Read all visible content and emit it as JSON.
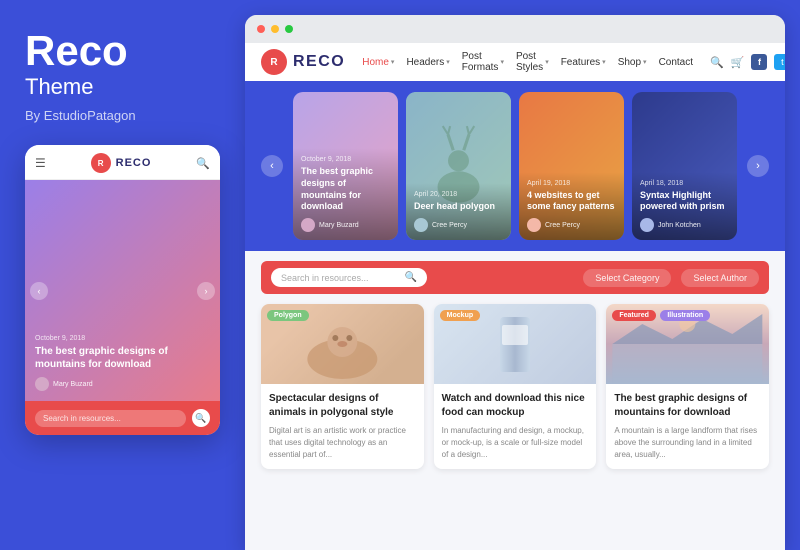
{
  "brand": {
    "title": "Reco",
    "subtitle": "Theme",
    "author": "By EstudioPatagon"
  },
  "mobile": {
    "logo": "R",
    "logo_text": "RECO",
    "hero_date": "October 9, 2018",
    "hero_title": "The best graphic designs of mountains for download",
    "hero_author": "Mary Buzard",
    "search_placeholder": "Search in resources...",
    "nav_prev": "‹",
    "nav_next": "›"
  },
  "browser": {
    "dots": [
      "#ff5f57",
      "#ffbd2e",
      "#28c941"
    ]
  },
  "site": {
    "logo": "R",
    "logo_text": "RECO",
    "nav": {
      "home": "Home",
      "headers": "Headers",
      "post_formats": "Post Formats",
      "post_styles": "Post Styles",
      "features": "Features",
      "shop": "Shop",
      "contact": "Contact"
    }
  },
  "hero_slider": {
    "nav_prev": "‹",
    "nav_next": "›",
    "cards": [
      {
        "date": "October 9, 2018",
        "title": "The best graphic designs of mountains for download",
        "author": "Mary Buzard",
        "bg": "card-bg-1"
      },
      {
        "date": "April 20, 2018",
        "title": "Deer head polygon",
        "author": "Cree Percy",
        "bg": "card-bg-2"
      },
      {
        "date": "April 19, 2018",
        "title": "4 websites to get some fancy patterns",
        "author": "Cree Percy",
        "bg": "card-bg-3"
      },
      {
        "date": "April 18, 2018",
        "title": "Syntax Highlight powered with prism",
        "author": "John Kotchen",
        "bg": "card-bg-4"
      }
    ]
  },
  "search_bar": {
    "placeholder": "Search in resources...",
    "search_icon": "🔍",
    "filter1": "Select Category",
    "filter2": "Select Author"
  },
  "articles": [
    {
      "tag": "Polygon",
      "tag_class": "tag-polygon",
      "title": "Spectacular designs of animals in polygonal style",
      "desc": "Digital art is an artistic work or practice that uses digital technology as an essential part of...",
      "img_class": "article-img-1"
    },
    {
      "tag": "Mockup",
      "tag_class": "tag-mockup",
      "title": "Watch and download this nice food can mockup",
      "desc": "In manufacturing and design, a mockup, or mock-up, is a scale or full-size model of a design...",
      "img_class": "article-img-2"
    },
    {
      "tag": "Featured",
      "tag_class": "tag-featured",
      "tag2": "Illustration",
      "tag2_class": "tag-illustration",
      "title": "The best graphic designs of mountains for download",
      "desc": "A mountain is a large landform that rises above the surrounding land in a limited area, usually...",
      "img_class": "article-img-3"
    }
  ]
}
